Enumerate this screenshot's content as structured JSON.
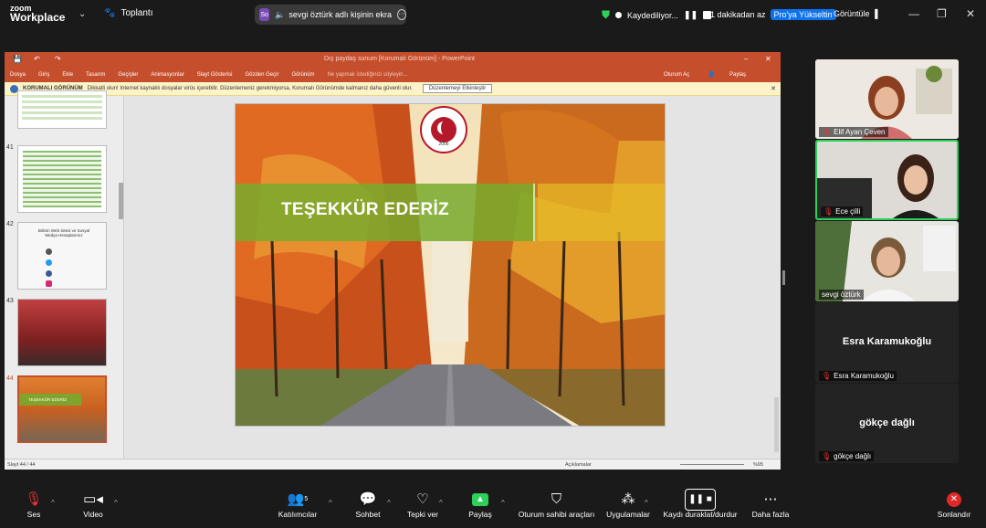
{
  "app": {
    "logo_top": "zoom",
    "logo_bottom": "Workplace",
    "meeting_label": "Toplantı"
  },
  "share_pill": {
    "avatar": "So",
    "text": "sevgi öztürk adlı kişinin ekra"
  },
  "recording": {
    "label": "Kaydediliyor..."
  },
  "remaining": {
    "text": "1 dakikadan az",
    "upgrade": "Pro'ya Yükseltin"
  },
  "view": {
    "label": "Görüntüle"
  },
  "powerpoint": {
    "title": "Dış paydaş sunum [Korumalı Görünüm] - PowerPoint",
    "menu": [
      "Dosya",
      "Giriş",
      "Ekle",
      "Tasarım",
      "Geçişler",
      "Animasyonlar",
      "Slayt Gösterisi",
      "Gözden Geçir",
      "Görünüm",
      "Ne yapmak istediğinizi söyleyin..."
    ],
    "signin": "Oturum Aç",
    "share": "Paylaş",
    "protected_title": "KORUMALI GÖRÜNÜM",
    "protected_text": "Dikkatli olun! Internet kaynaklı dosyalar virüs içerebilir. Düzenlemeniz gerekmiyorsa, Korumalı Görünümde kalmanız daha güvenli olur.",
    "enable_button": "Düzenlemeyi Etkinleştir",
    "thumb_numbers": [
      "41",
      "42",
      "43",
      "44"
    ],
    "thumb42_text": "Bölüm Web Sitesi ve Sosyal Medya Hesaplarımız",
    "thumb44_text": "TEŞEKKÜR EDERİZ",
    "slide_title": "TEŞEKKÜR EDERİZ",
    "seal_year": "2006",
    "status_left": "Slayt 44 / 44",
    "status_comments": "Açıklamalar",
    "zoom": "%95"
  },
  "participants": [
    {
      "name": "Elif Ayan Çeven"
    },
    {
      "name": "Ece çilli"
    },
    {
      "name": "sevgi öztürk"
    },
    {
      "name": "Esra Karamukoğlu",
      "big": "Esra Karamukoğlu"
    },
    {
      "name": "gökçe dağlı",
      "big": "gökçe dağlı"
    }
  ],
  "toolbar": {
    "mute": "Ses",
    "video": "Video",
    "participants": "Katılımcılar",
    "participants_count": "5",
    "chat": "Sohbet",
    "react": "Tepki ver",
    "share": "Paylaş",
    "host_tools": "Oturum sahibi araçları",
    "apps": "Uygulamalar",
    "record": "Kaydı duraklat/durdur",
    "more": "Daha fazla",
    "end": "Sonlandır"
  },
  "colors": {
    "accent_green": "#2bd159",
    "ppt_red": "#c54e2c",
    "zoom_blue": "#0e72ed",
    "end_red": "#e02828"
  }
}
